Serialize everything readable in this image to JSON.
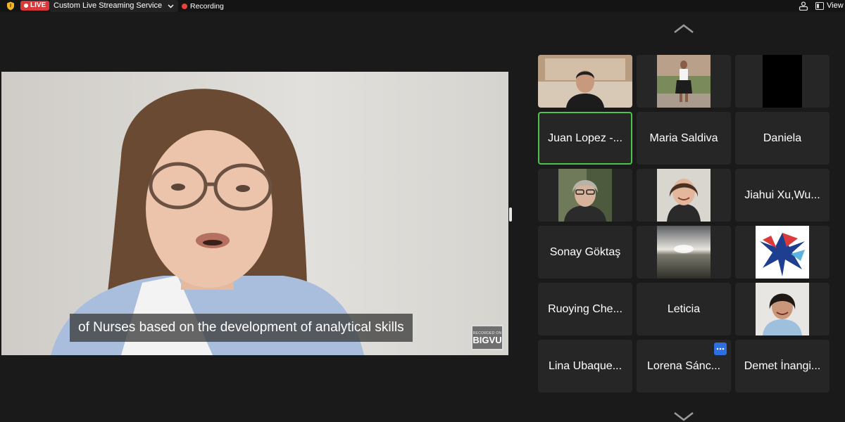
{
  "topbar": {
    "live_label": "LIVE",
    "service_name": "Custom Live Streaming Service",
    "recording_label": "Recording",
    "view_label": "View"
  },
  "main_video": {
    "caption": "of Nurses based on the development of analytical skills",
    "watermark_small": "RECORDED ON",
    "watermark_big": "BIGVU"
  },
  "gallery": {
    "tiles": [
      {
        "name": "",
        "type": "video"
      },
      {
        "name": "",
        "type": "video"
      },
      {
        "name": "",
        "type": "video"
      },
      {
        "name": "Juan Lopez -...",
        "type": "name",
        "active": true
      },
      {
        "name": "Maria Saldiva",
        "type": "name"
      },
      {
        "name": "Daniela",
        "type": "name"
      },
      {
        "name": "",
        "type": "video"
      },
      {
        "name": "",
        "type": "video"
      },
      {
        "name": "Jiahui Xu,Wu...",
        "type": "name"
      },
      {
        "name": "Sonay Göktaş",
        "type": "name"
      },
      {
        "name": "",
        "type": "video"
      },
      {
        "name": "",
        "type": "video"
      },
      {
        "name": "Ruoying Che...",
        "type": "name"
      },
      {
        "name": "Leticia",
        "type": "name"
      },
      {
        "name": "",
        "type": "video"
      },
      {
        "name": "Lina Ubaque...",
        "type": "name"
      },
      {
        "name": "Lorena Sánc...",
        "type": "name"
      },
      {
        "name": "Demet İnangi...",
        "type": "name"
      }
    ]
  },
  "colors": {
    "live_red": "#d9393a",
    "active_speaker_border": "#4ec14f",
    "recording_dot": "#e5433c",
    "more_button": "#2d6fe0"
  }
}
